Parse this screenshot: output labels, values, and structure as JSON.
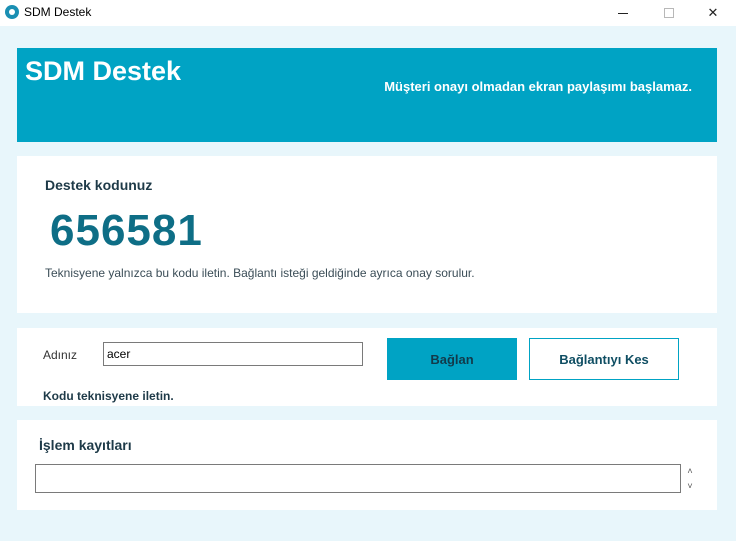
{
  "window": {
    "title": "SDM Destek",
    "minimize_glyph": "",
    "close_glyph": "✕"
  },
  "header": {
    "title": "SDM Destek",
    "notice": "Müşteri onayı olmadan ekran paylaşımı başlamaz."
  },
  "support_code": {
    "heading": "Destek kodunuz",
    "value": "656581",
    "hint": "Teknisyene yalnızca bu kodu iletin. Bağlantı isteği geldiğinde ayrıca onay sorulur."
  },
  "connection": {
    "name_label": "Adınız",
    "name_value": "acer",
    "connect_label": "Bağlan",
    "disconnect_label": "Bağlantıyı Kes",
    "status": "Kodu teknisyene iletin."
  },
  "log": {
    "heading": "İşlem kayıtları",
    "content": "",
    "spin_up": "˄",
    "spin_down": "˅"
  },
  "colors": {
    "accent": "#00a3c4",
    "code_color": "#0e6e86",
    "background": "#e8f6fb"
  }
}
